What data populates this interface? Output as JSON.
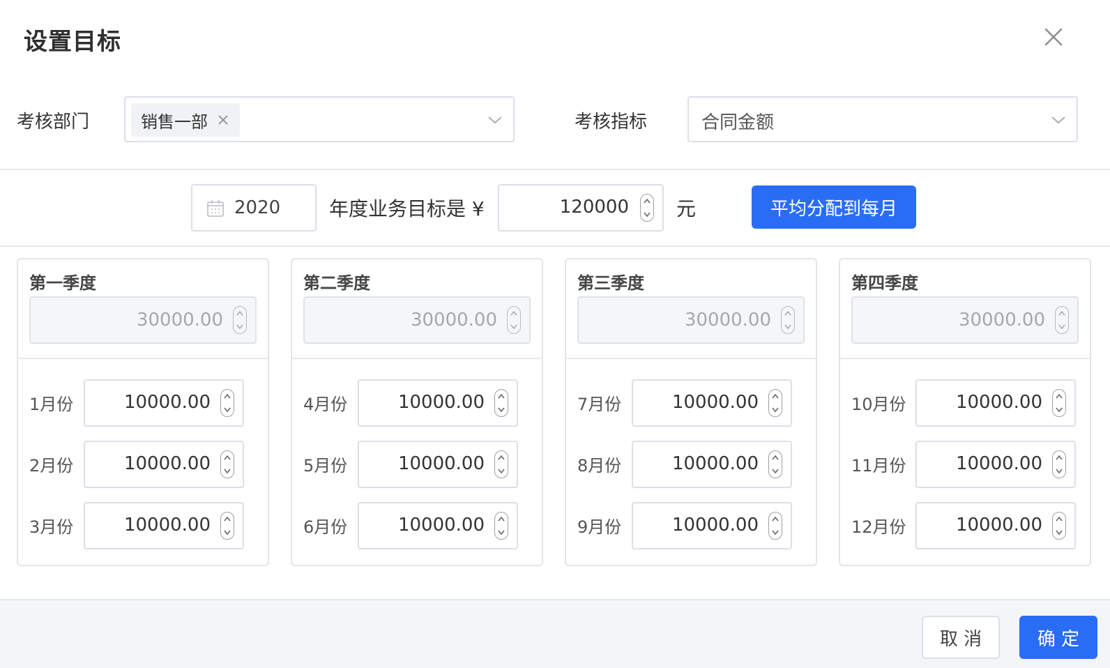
{
  "dialog": {
    "title": "设置目标"
  },
  "filters": {
    "department_label": "考核部门",
    "department_tag": "销售一部",
    "metric_label": "考核指标",
    "metric_value": "合同金额"
  },
  "annual": {
    "year": "2020",
    "label": "年度业务目标是 ¥",
    "amount": "120000",
    "unit": "元",
    "distribute_button": "平均分配到每月"
  },
  "quarters": [
    {
      "title": "第一季度",
      "total": "30000.00",
      "months": [
        {
          "label": "1月份",
          "value": "10000.00"
        },
        {
          "label": "2月份",
          "value": "10000.00"
        },
        {
          "label": "3月份",
          "value": "10000.00"
        }
      ]
    },
    {
      "title": "第二季度",
      "total": "30000.00",
      "months": [
        {
          "label": "4月份",
          "value": "10000.00"
        },
        {
          "label": "5月份",
          "value": "10000.00"
        },
        {
          "label": "6月份",
          "value": "10000.00"
        }
      ]
    },
    {
      "title": "第三季度",
      "total": "30000.00",
      "months": [
        {
          "label": "7月份",
          "value": "10000.00"
        },
        {
          "label": "8月份",
          "value": "10000.00"
        },
        {
          "label": "9月份",
          "value": "10000.00"
        }
      ]
    },
    {
      "title": "第四季度",
      "total": "30000.00",
      "months": [
        {
          "label": "10月份",
          "value": "10000.00"
        },
        {
          "label": "11月份",
          "value": "10000.00"
        },
        {
          "label": "12月份",
          "value": "10000.00"
        }
      ]
    }
  ],
  "footer": {
    "cancel_label": "取 消",
    "confirm_label": "确 定"
  },
  "colors": {
    "primary": "#2a6df5",
    "border": "#dcdfe6",
    "disabled_bg": "#f5f6f8",
    "footer_bg": "#f4f5f7"
  },
  "icons": {
    "close": "close-icon",
    "chevron": "chevron-down-icon",
    "tag_remove": "tag-remove-icon",
    "calendar": "calendar-icon",
    "spinner": "spinner-icon"
  }
}
